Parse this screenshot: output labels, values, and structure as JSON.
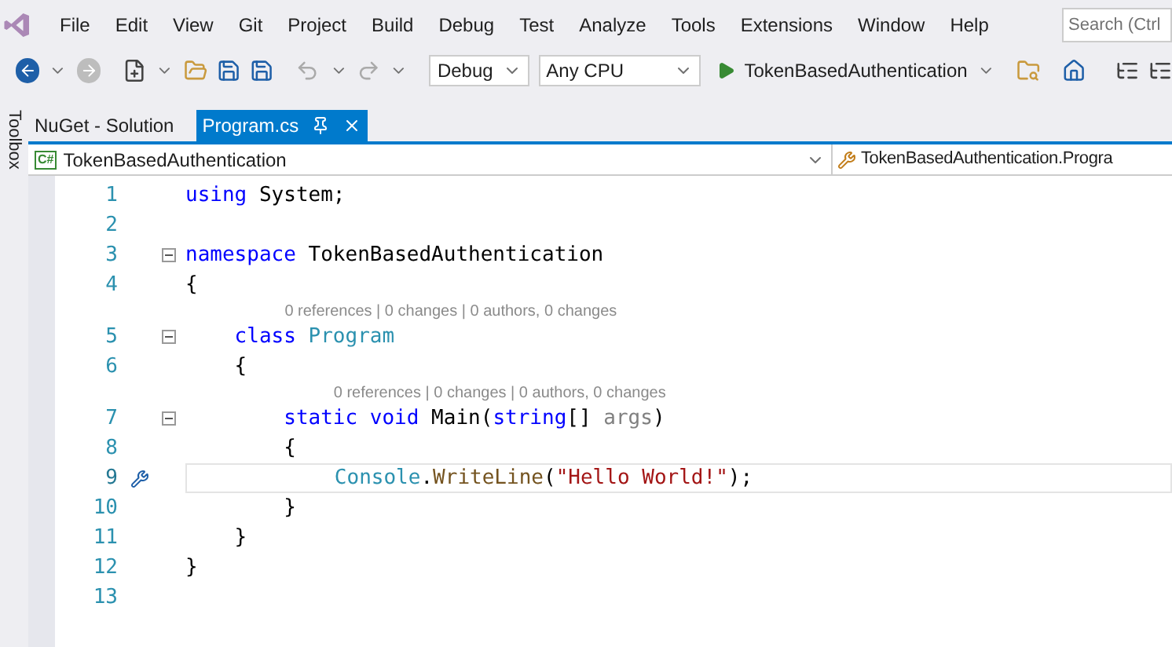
{
  "menu": [
    "File",
    "Edit",
    "View",
    "Git",
    "Project",
    "Build",
    "Debug",
    "Test",
    "Analyze",
    "Tools",
    "Extensions",
    "Window",
    "Help"
  ],
  "search": {
    "placeholder": "Search (Ctrl"
  },
  "toolbar": {
    "configuration": "Debug",
    "platform": "Any CPU",
    "startup": "TokenBasedAuthentication"
  },
  "toolbox": {
    "label": "Toolbox"
  },
  "tabs": [
    {
      "label": "NuGet - Solution",
      "selected": false
    },
    {
      "label": "Program.cs",
      "selected": true
    }
  ],
  "navbar": {
    "project_badge": "C#",
    "project": "TokenBasedAuthentication",
    "type": "TokenBasedAuthentication.Progra"
  },
  "code": [
    {
      "number": "1",
      "fold": false,
      "current": false,
      "tokens": [
        {
          "kind": "keyword",
          "text": "using"
        },
        {
          "kind": "plain",
          "text": " System;"
        }
      ]
    },
    {
      "number": "2",
      "fold": false,
      "current": false
    },
    {
      "number": "3",
      "fold": true,
      "current": false,
      "tokens": [
        {
          "kind": "keyword",
          "text": "namespace"
        },
        {
          "kind": "plain",
          "text": " TokenBasedAuthentication"
        }
      ]
    },
    {
      "number": "4",
      "fold": false,
      "current": false,
      "tokens": [
        {
          "kind": "plain",
          "text": "{"
        }
      ]
    },
    {
      "number": "5",
      "fold": true,
      "current": false,
      "lens": "0 references | 0 changes | 0 authors, 0 changes",
      "tokens": [
        {
          "kind": "keyword",
          "text": "    class"
        },
        {
          "kind": "type",
          "text": " Program"
        }
      ]
    },
    {
      "number": "6",
      "fold": false,
      "current": false,
      "tokens": [
        {
          "kind": "plain",
          "text": "    {"
        }
      ]
    },
    {
      "number": "7",
      "fold": true,
      "current": false,
      "lens": "0 references | 0 changes | 0 authors, 0 changes",
      "tokens": [
        {
          "kind": "keyword",
          "text": "        static"
        },
        {
          "kind": "keyword",
          "text": " void"
        },
        {
          "kind": "plain",
          "text": " Main("
        },
        {
          "kind": "keyword",
          "text": "string"
        },
        {
          "kind": "plain",
          "text": "[] "
        },
        {
          "kind": "unused",
          "text": "args"
        },
        {
          "kind": "plain",
          "text": ")"
        }
      ]
    },
    {
      "number": "8",
      "fold": false,
      "current": false,
      "tokens": [
        {
          "kind": "plain",
          "text": "        {"
        }
      ]
    },
    {
      "number": "9",
      "fold": false,
      "current": true,
      "tokens": [
        {
          "kind": "type",
          "text": "            Console"
        },
        {
          "kind": "plain",
          "text": "."
        },
        {
          "kind": "method",
          "text": "WriteLine"
        },
        {
          "kind": "plain",
          "text": "("
        },
        {
          "kind": "string",
          "text": "\"Hello World!\""
        },
        {
          "kind": "plain",
          "text": ");"
        }
      ]
    },
    {
      "number": "10",
      "fold": false,
      "current": false,
      "tokens": [
        {
          "kind": "plain",
          "text": "        }"
        }
      ]
    },
    {
      "number": "11",
      "fold": false,
      "current": false,
      "tokens": [
        {
          "kind": "plain",
          "text": "    }"
        }
      ]
    },
    {
      "number": "12",
      "fold": false,
      "current": false,
      "tokens": [
        {
          "kind": "plain",
          "text": "}"
        }
      ]
    },
    {
      "number": "13",
      "fold": false,
      "current": false
    }
  ]
}
